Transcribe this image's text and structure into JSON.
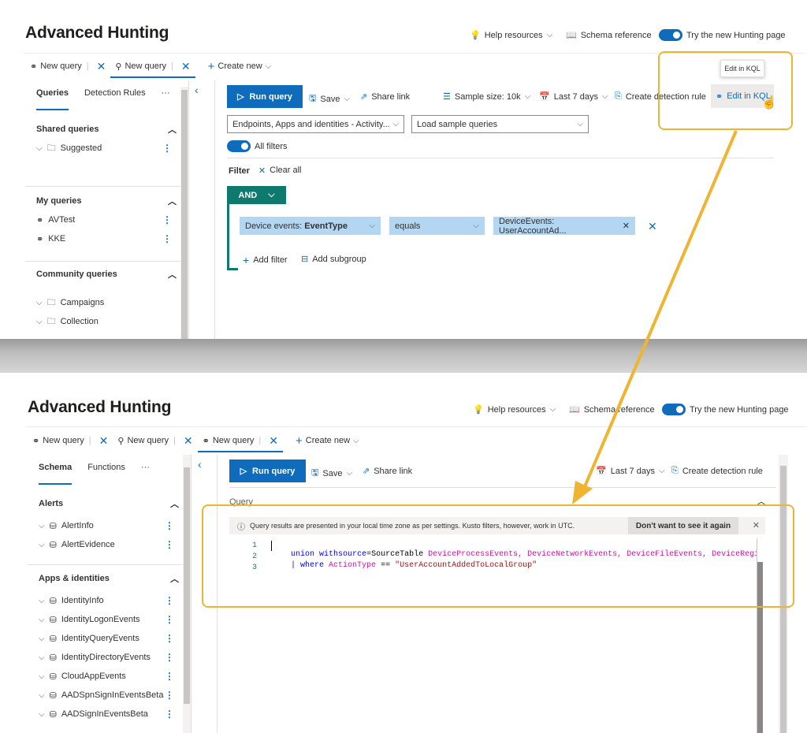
{
  "top": {
    "title": "Advanced Hunting",
    "header": {
      "help": "Help resources",
      "schema": "Schema reference",
      "try": "Try the new Hunting page"
    },
    "tabs": [
      {
        "label": "New query"
      },
      {
        "label": "New query"
      }
    ],
    "create_new": "Create new",
    "sidebar": {
      "tabs": [
        "Queries",
        "Detection Rules"
      ],
      "more": "···",
      "shared": {
        "title": "Shared queries",
        "items": [
          "Suggested"
        ]
      },
      "mine": {
        "title": "My queries",
        "items": [
          "AVTest",
          "KKE"
        ]
      },
      "community": {
        "title": "Community queries",
        "items": [
          "Campaigns",
          "Collection"
        ]
      }
    },
    "toolbar": {
      "run": "Run query",
      "save": "Save",
      "share": "Share link",
      "sample": "Sample size: 10k",
      "range": "Last 7 days",
      "detection": "Create detection rule",
      "kql": "Edit in KQL",
      "tooltip": "Edit in KQL"
    },
    "scope_dropdown": "Endpoints, Apps and identities - Activity...",
    "sample_dropdown": "Load sample queries",
    "all_filters": "All filters",
    "filter_label": "Filter",
    "clear_all": "Clear all",
    "and_label": "AND",
    "condition": {
      "field_prefix": "Device events: ",
      "field_bold": "EventType",
      "operator": "equals",
      "value": "DeviceEvents: UserAccountAd..."
    },
    "add_filter": "Add filter",
    "add_subgroup": "Add subgroup"
  },
  "bottom": {
    "title": "Advanced Hunting",
    "header": {
      "help": "Help resources",
      "schema": "Schema reference",
      "try": "Try the new Hunting page"
    },
    "tabs": [
      {
        "label": "New query"
      },
      {
        "label": "New query"
      },
      {
        "label": "New query"
      }
    ],
    "create_new": "Create new",
    "sidebar": {
      "tabs": [
        "Schema",
        "Functions"
      ],
      "more": "···",
      "alerts": {
        "title": "Alerts",
        "items": [
          "AlertInfo",
          "AlertEvidence"
        ]
      },
      "apps": {
        "title": "Apps & identities",
        "items": [
          "IdentityInfo",
          "IdentityLogonEvents",
          "IdentityQueryEvents",
          "IdentityDirectoryEvents",
          "CloudAppEvents",
          "AADSpnSignInEventsBeta",
          "AADSignInEventsBeta"
        ]
      }
    },
    "toolbar": {
      "run": "Run query",
      "save": "Save",
      "share": "Share link",
      "range": "Last 7 days",
      "detection": "Create detection rule"
    },
    "query_label": "Query",
    "info": "Query results are presented in your local time zone as per settings. Kusto filters, however, work in UTC.",
    "dismiss": "Don't want to see it again",
    "code": {
      "line_numbers": [
        "1",
        "2",
        "3"
      ],
      "l1_kw": "union",
      "l1_kw2": " withsource",
      "l1_eq": "=",
      "l1_src": "SourceTable ",
      "l1_tables": "DeviceProcessEvents, DeviceNetworkEvents, DeviceFileEvents, DeviceRegistryEvent",
      "l2_pipe": "| ",
      "l2_where": "where ",
      "l2_col": "ActionType ",
      "l2_op": "== ",
      "l2_str": "\"UserAccountAddedToLocalGroup\""
    }
  },
  "colors": {
    "accent": "#0f6cbd",
    "highlight": "#f0b433",
    "teal": "#0e7a6e",
    "chip": "#b3d6f2"
  }
}
